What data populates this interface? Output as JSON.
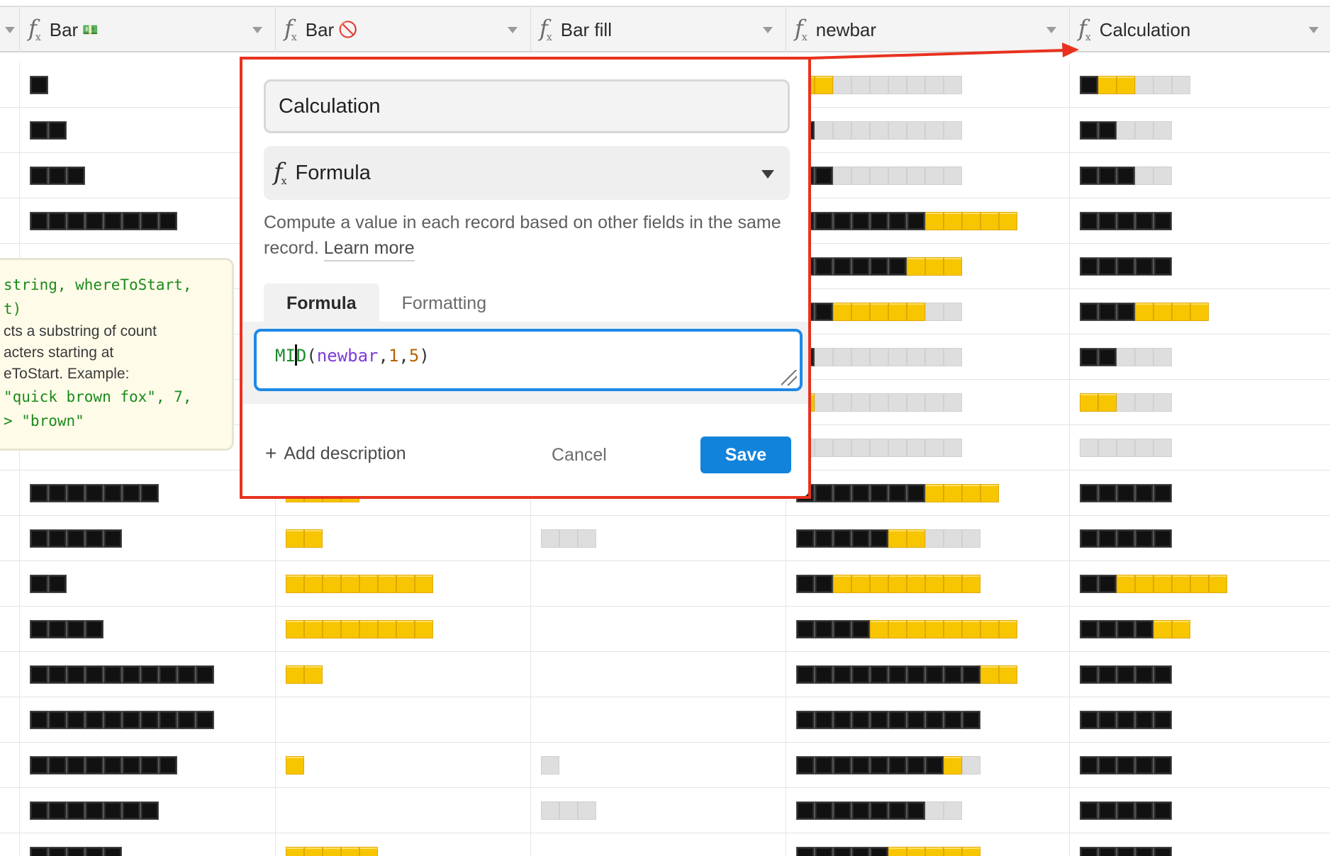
{
  "columns": [
    {
      "key": "bar_money",
      "label": "Bar",
      "badge": "💵",
      "icon": "formula-icon"
    },
    {
      "key": "bar_no",
      "label": "Bar",
      "badge": "🚫",
      "icon": "formula-icon"
    },
    {
      "key": "bar_fill",
      "label": "Bar fill",
      "badge": "",
      "icon": "formula-icon"
    },
    {
      "key": "newbar",
      "label": "newbar",
      "badge": "",
      "icon": "formula-icon"
    },
    {
      "key": "calculation",
      "label": "Calculation",
      "badge": "",
      "icon": "formula-icon"
    }
  ],
  "bar_legend": {
    "k": "black square",
    "y": "yellow square",
    "g": "grey square"
  },
  "rows": [
    {
      "bar_money": "k",
      "bar_no": "",
      "bar_fill": "",
      "newbar": "yyggggggg",
      "calculation": "kyyggg"
    },
    {
      "bar_money": "kk",
      "bar_no": "",
      "bar_fill": "",
      "newbar": "kgggggggg",
      "calculation": "kkggg"
    },
    {
      "bar_money": "kkk",
      "bar_no": "",
      "bar_fill": "",
      "newbar": "kkggggggg",
      "calculation": "kkkgg"
    },
    {
      "bar_money": "kkkkkkkk",
      "bar_no": "",
      "bar_fill": "",
      "newbar": "kkkkkkkyyyyy",
      "calculation": "kkkkk"
    },
    {
      "bar_money": "",
      "bar_no": "",
      "bar_fill": "",
      "newbar": "kkkkkkyyy",
      "calculation": "kkkkk"
    },
    {
      "bar_money": "",
      "bar_no": "",
      "bar_fill": "",
      "newbar": "kkyyyyygg",
      "calculation": "kkkyyyy"
    },
    {
      "bar_money": "",
      "bar_no": "",
      "bar_fill": "",
      "newbar": "kgggggggg",
      "calculation": "kkggg"
    },
    {
      "bar_money": "",
      "bar_no": "",
      "bar_fill": "",
      "newbar": "ygggggggg",
      "calculation": "yyggg"
    },
    {
      "bar_money": "",
      "bar_no": "",
      "bar_fill": "",
      "newbar": "ggggggggg",
      "calculation": "ggggg"
    },
    {
      "bar_money": "kkkkkkk",
      "bar_no": "yyyy",
      "bar_fill": "",
      "newbar": "kkkkkkkyyyy",
      "calculation": "kkkkk"
    },
    {
      "bar_money": "kkkkk",
      "bar_no": "yy",
      "bar_fill": "ggg",
      "newbar": "kkkkkyyggg",
      "calculation": "kkkkk"
    },
    {
      "bar_money": "kk",
      "bar_no": "yyyyyyyy",
      "bar_fill": "",
      "newbar": "kkyyyyyyyy",
      "calculation": "kkyyyyyy"
    },
    {
      "bar_money": "kkkk",
      "bar_no": "yyyyyyyy",
      "bar_fill": "",
      "newbar": "kkkkyyyyyyyy",
      "calculation": "kkkkyy"
    },
    {
      "bar_money": "kkkkkkkkkk",
      "bar_no": "yy",
      "bar_fill": "",
      "newbar": "kkkkkkkkkkyy",
      "calculation": "kkkkk"
    },
    {
      "bar_money": "kkkkkkkkkk",
      "bar_no": "",
      "bar_fill": "",
      "newbar": "kkkkkkkkkk",
      "calculation": "kkkkk"
    },
    {
      "bar_money": "kkkkkkkk",
      "bar_no": "y",
      "bar_fill": "g",
      "newbar": "kkkkkkkkyg",
      "calculation": "kkkkk"
    },
    {
      "bar_money": "kkkkkkk",
      "bar_no": "",
      "bar_fill": "ggg",
      "newbar": "kkkkkkkgg",
      "calculation": "kkkkk"
    },
    {
      "bar_money": "kkkkk",
      "bar_no": "yyyyy",
      "bar_fill": "",
      "newbar": "kkkkkyyyyy",
      "calculation": "kkkkk"
    }
  ],
  "tooltip": {
    "line1": "string, whereToStart,",
    "line2": "t)",
    "line3": "cts a substring of count",
    "line4": "acters starting at",
    "line5": "eToStart. Example:",
    "line6": "\"quick brown fox\", 7,",
    "line7": "> \"brown\""
  },
  "dialog": {
    "field_name": "Calculation",
    "type_label": "Formula",
    "type_icon": "formula-icon",
    "description": "Compute a value in each record based on other fields in the same record.",
    "learn_more": "Learn more",
    "tabs": [
      "Formula",
      "Formatting"
    ],
    "active_tab": "Formula",
    "formula": {
      "fn": "MID",
      "open": "(",
      "field": "newbar",
      "sep1": ",",
      "arg1": "1",
      "sep2": ",",
      "arg2": "5",
      "close": ")"
    },
    "add_description": "Add description",
    "cancel": "Cancel",
    "save": "Save"
  },
  "colors": {
    "accent": "#1283da",
    "annotation": "#e8321f",
    "bar_black": "#111111",
    "bar_yellow": "#f7c600",
    "bar_grey": "#dedede"
  }
}
